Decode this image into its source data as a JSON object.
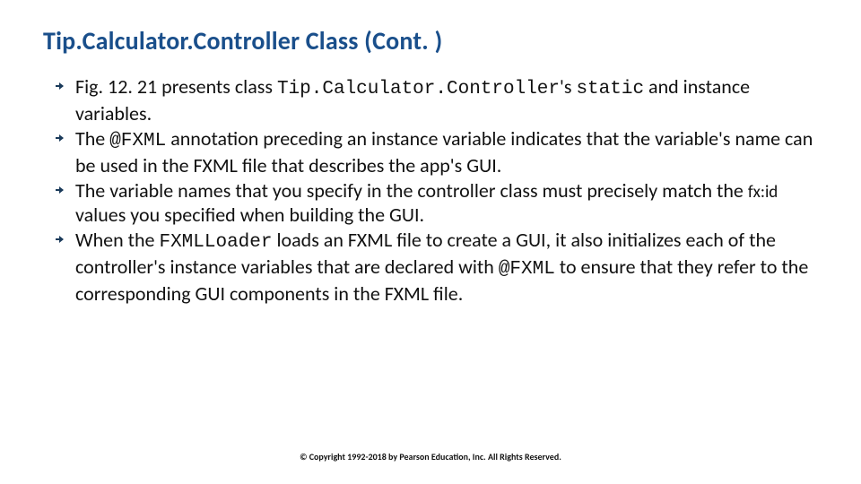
{
  "title": "Tip.Calculator.Controller Class (Cont. )",
  "bullets": [
    {
      "parts": [
        {
          "text": "Fig. 12. 21 presents class ",
          "cls": ""
        },
        {
          "text": "Tip.Calculator.Controller",
          "cls": "code"
        },
        {
          "text": "'s ",
          "cls": ""
        },
        {
          "text": "static",
          "cls": "code"
        },
        {
          "text": " and instance variables.",
          "cls": ""
        }
      ]
    },
    {
      "parts": [
        {
          "text": "The ",
          "cls": ""
        },
        {
          "text": "@FXML",
          "cls": "code"
        },
        {
          "text": " annotation preceding an instance variable indicates that the variable's name can be used in the FXML file that describes the app's GUI.",
          "cls": ""
        }
      ]
    },
    {
      "parts": [
        {
          "text": "The variable names that you specify in the controller class must precisely match the ",
          "cls": ""
        },
        {
          "text": "fx:id",
          "cls": "small-code"
        },
        {
          "text": " values you specified when building the GUI.",
          "cls": ""
        }
      ]
    },
    {
      "parts": [
        {
          "text": "When the ",
          "cls": ""
        },
        {
          "text": "FXMLLoader",
          "cls": "code"
        },
        {
          "text": " loads an FXML file to create a GUI, it also initializes each of the controller's instance variables that are declared with ",
          "cls": ""
        },
        {
          "text": "@FXML",
          "cls": "code"
        },
        {
          "text": " to ensure that they refer to the corresponding GUI components in the FXML file.",
          "cls": ""
        }
      ]
    }
  ],
  "footer": "© Copyright 1992-2018 by Pearson Education, Inc. All Rights Reserved."
}
